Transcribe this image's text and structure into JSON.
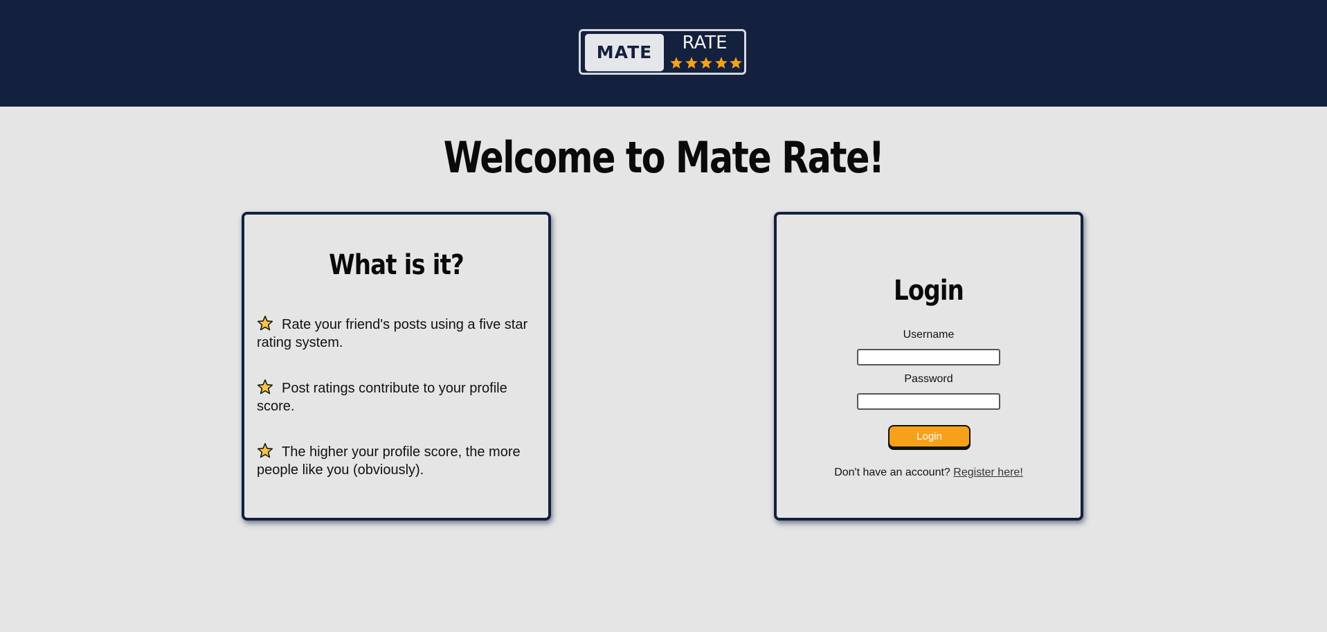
{
  "header": {
    "logo": {
      "left_text": "MATE",
      "right_text": "RATE",
      "star_count": 5,
      "star_color": "#f7a11a"
    },
    "background_color": "#13203e"
  },
  "main": {
    "title": "Welcome to Mate Rate!"
  },
  "about_card": {
    "title": "What is it?",
    "icon": "star-icon",
    "features": [
      "Rate your friend's posts using a five star rating system.",
      "Post ratings contribute to your profile score.",
      "The higher your profile score, the more people like you (obviously)."
    ]
  },
  "login_card": {
    "title": "Login",
    "username_label": "Username",
    "username_value": "",
    "password_label": "Password",
    "password_value": "",
    "submit_label": "Login",
    "register_prompt": "Don't have an account?",
    "register_link": "Register here!",
    "accent_color": "#f7a11a"
  }
}
